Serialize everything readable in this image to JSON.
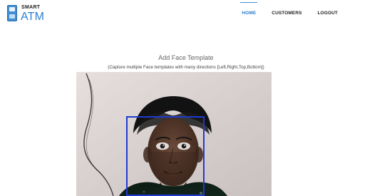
{
  "header": {
    "logo": {
      "top": "SMART",
      "bottom": "ATM"
    },
    "nav": {
      "home": "HOME",
      "customers": "CUSTOMERS",
      "logout": "LOGOUT"
    }
  },
  "main": {
    "title": "Add Face Template",
    "subtitle": "(Capture multiple Face templates with many directions [Left,Right,Top,Bottom])"
  },
  "colors": {
    "accent": "#2a7fd0",
    "face_box": "#1f3ad0"
  }
}
